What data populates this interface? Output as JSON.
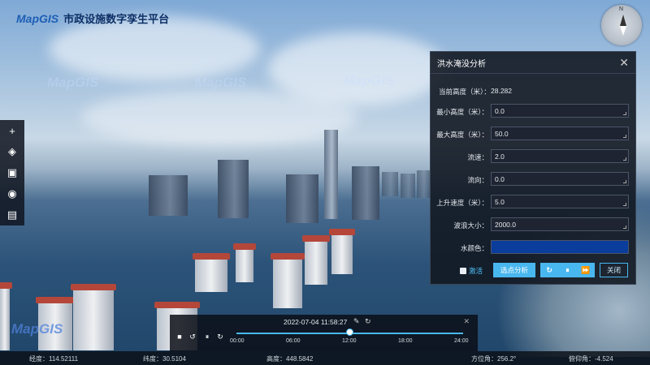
{
  "app": {
    "logo_text": "MapGIS",
    "title": "市政设施数字孪生平台"
  },
  "watermark": "MapGIS",
  "compass": {
    "north_label": "N"
  },
  "toolbar": {
    "items": [
      {
        "icon": "plus-icon",
        "glyph": "+"
      },
      {
        "icon": "layers-icon",
        "glyph": "◈"
      },
      {
        "icon": "cube-icon",
        "glyph": "▣"
      },
      {
        "icon": "globe-icon",
        "glyph": "◉"
      },
      {
        "icon": "save-icon",
        "glyph": "▤"
      }
    ]
  },
  "panel": {
    "title": "洪水淹没分析",
    "close_glyph": "✕",
    "current_height_label": "当前高度（米）：",
    "current_height_value": "28.282",
    "fields": [
      {
        "label": "最小高度（米）：",
        "value": "0.0"
      },
      {
        "label": "最大高度（米）：",
        "value": "50.0"
      },
      {
        "label": "流速：",
        "value": "2.0"
      },
      {
        "label": "流向：",
        "value": "0.0"
      },
      {
        "label": "上升速度（米）：",
        "value": "5.0"
      },
      {
        "label": "波浪大小：",
        "value": "2000.0"
      }
    ],
    "color_label": "水颜色：",
    "water_color": "#0a3d9c",
    "activate_label": "激活",
    "pick_button": "选点分析",
    "icons": {
      "refresh": "↻",
      "pause": "⏸",
      "forward": "⏩"
    },
    "close_button": "关闭"
  },
  "timeline": {
    "datetime": "2022-07-04 11:58:27",
    "edit_glyph": "✎",
    "refresh_glyph": "↻",
    "close_glyph": "✕",
    "controls": {
      "stop": "■",
      "back": "↺",
      "pause": "⏸",
      "forward": "↻"
    },
    "ticks": [
      "00:00",
      "06:00",
      "12:00",
      "18:00",
      "24:00"
    ],
    "progress": 0.4988
  },
  "status": {
    "longitude": "经度：114.52111",
    "latitude": "纬度：30.5104",
    "altitude": "高度：448.5842",
    "heading": "方位角：256.2°",
    "pitch": "俯仰角：-4.524"
  },
  "colors": {
    "accent": "#49b7ef",
    "brand": "#1d5fb5",
    "roof": "#b4473a"
  }
}
